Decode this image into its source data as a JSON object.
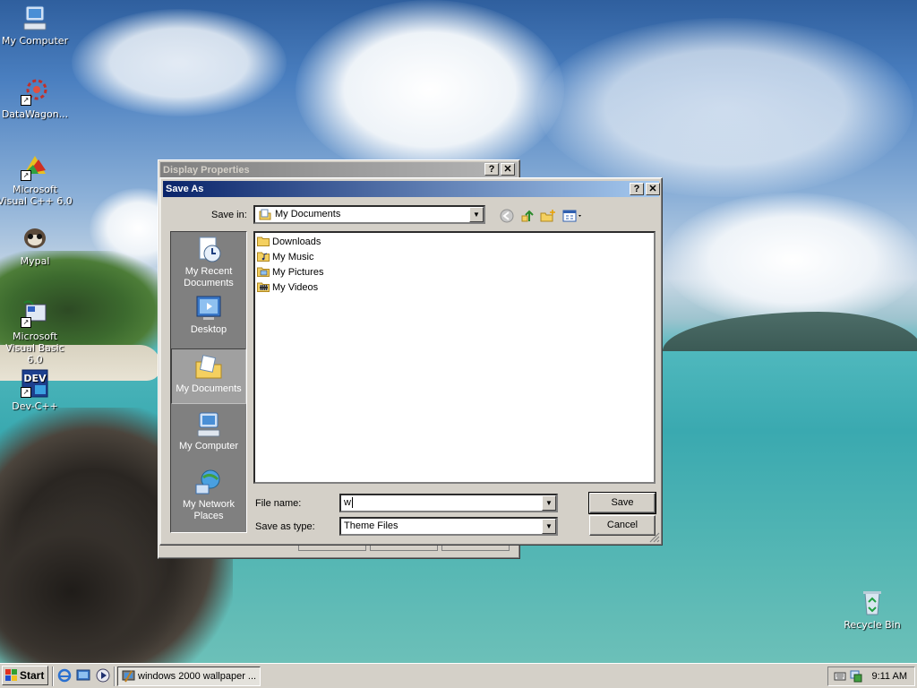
{
  "desktop": {
    "icons": [
      {
        "label": "My Computer",
        "icon": "my-computer-icon"
      },
      {
        "label": "DataWagon...",
        "icon": "datawagon-icon"
      },
      {
        "label": "Microsoft Visual C++ 6.0",
        "icon": "visual-cpp-icon"
      },
      {
        "label": "Mypal",
        "icon": "mypal-icon"
      },
      {
        "label": "Microsoft Visual Basic 6.0",
        "icon": "visual-basic-icon"
      },
      {
        "label": "Dev-C++",
        "icon": "dev-cpp-icon"
      },
      {
        "label": "Recycle Bin",
        "icon": "recycle-bin-icon"
      }
    ],
    "dev_icon_text": "DEV"
  },
  "display_properties": {
    "title": "Display Properties",
    "help": "?",
    "close": "✕"
  },
  "save_as": {
    "title": "Save As",
    "help": "?",
    "close": "✕",
    "save_in_label": "Save in:",
    "save_in_value": "My Documents",
    "places": [
      {
        "label": "My Recent Documents",
        "icon": "recent-documents-icon"
      },
      {
        "label": "Desktop",
        "icon": "desktop-icon"
      },
      {
        "label": "My Documents",
        "icon": "my-documents-icon",
        "selected": true
      },
      {
        "label": "My Computer",
        "icon": "my-computer-icon"
      },
      {
        "label": "My Network Places",
        "icon": "network-places-icon"
      }
    ],
    "files": [
      {
        "name": "Downloads",
        "icon": "folder-icon"
      },
      {
        "name": "My Music",
        "icon": "music-folder-icon"
      },
      {
        "name": "My Pictures",
        "icon": "pictures-folder-icon"
      },
      {
        "name": "My Videos",
        "icon": "videos-folder-icon"
      }
    ],
    "file_name_label": "File name:",
    "file_name_value": "w",
    "save_type_label": "Save as type:",
    "save_type_value": "Theme Files",
    "save_button": "Save",
    "cancel_button": "Cancel"
  },
  "taskbar": {
    "start_label": "Start",
    "task_label": "windows 2000 wallpaper ...",
    "clock": "9:11 AM"
  },
  "colors": {
    "active_title": "#0a246a",
    "inactive_title": "#808080",
    "face": "#d4d0c8"
  }
}
